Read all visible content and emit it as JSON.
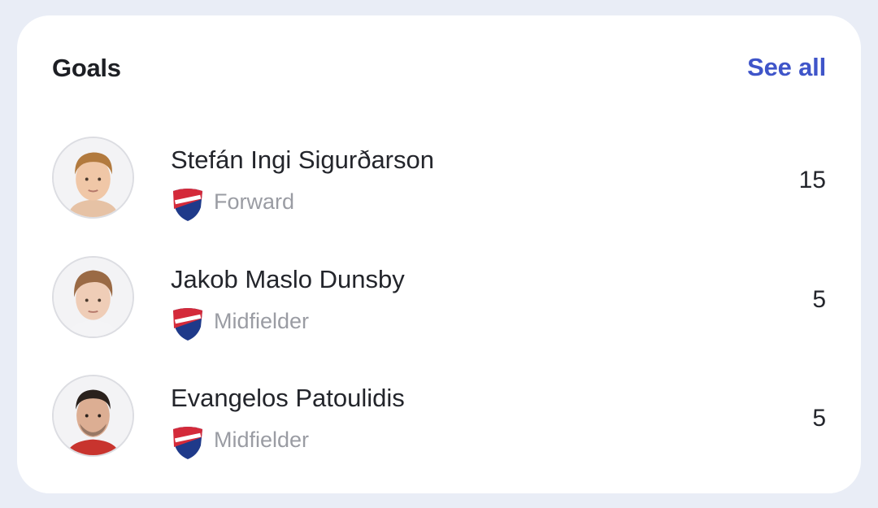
{
  "card": {
    "title": "Goals",
    "see_all_label": "See all"
  },
  "players": [
    {
      "name": "Stefán Ingi Sigurðarson",
      "position": "Forward",
      "value": "15",
      "club_icon": "sandefjord-crest-icon",
      "avatar_icon": "player-photo"
    },
    {
      "name": "Jakob Maslo Dunsby",
      "position": "Midfielder",
      "value": "5",
      "club_icon": "sandefjord-crest-icon",
      "avatar_icon": "player-photo"
    },
    {
      "name": "Evangelos Patoulidis",
      "position": "Midfielder",
      "value": "5",
      "club_icon": "sandefjord-crest-icon",
      "avatar_icon": "player-photo"
    }
  ],
  "colors": {
    "background": "#e9edf6",
    "card": "#ffffff",
    "accent": "#3f55c9",
    "text_primary": "#23252b",
    "text_secondary": "#9a9ca3",
    "crest_red": "#d42a3a",
    "crest_blue": "#1f3a8a"
  }
}
